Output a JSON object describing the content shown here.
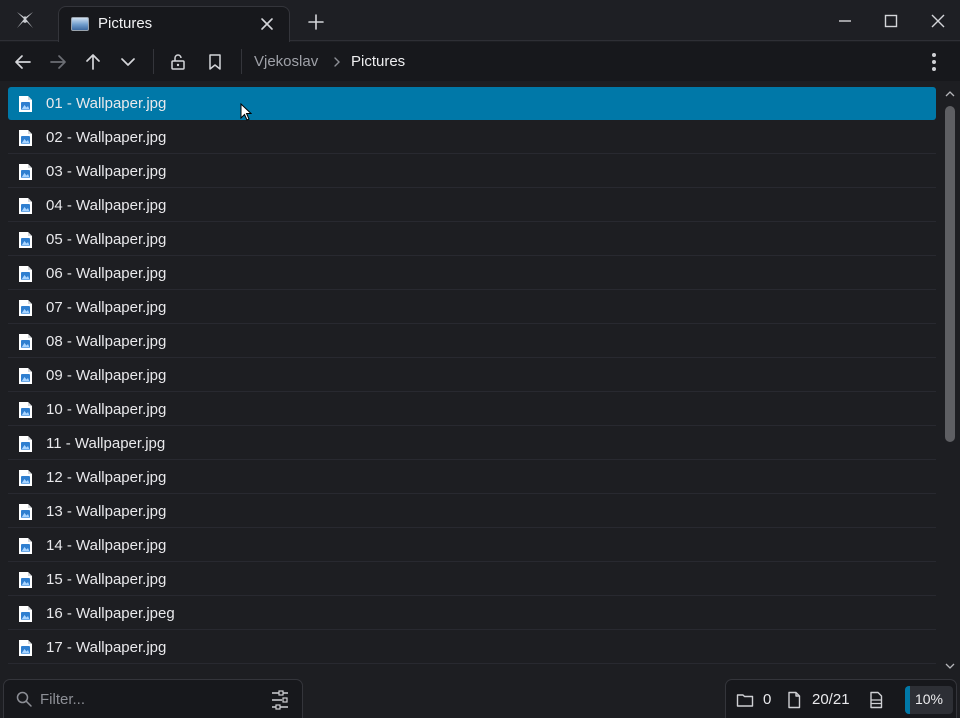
{
  "window": {
    "tab_title": "Pictures",
    "tab_icon": "pictures-folder-icon"
  },
  "toolbar": {
    "buttons": [
      "back-icon",
      "forward-icon",
      "up-icon",
      "dropdown-icon",
      "unlock-icon",
      "bookmark-icon",
      "more-icon"
    ],
    "breadcrumb": {
      "parent": "Vjekoslav",
      "current": "Pictures"
    }
  },
  "files": [
    {
      "name": "01 - Wallpaper.jpg",
      "selected": true
    },
    {
      "name": "02 - Wallpaper.jpg"
    },
    {
      "name": "03 - Wallpaper.jpg"
    },
    {
      "name": "04 - Wallpaper.jpg"
    },
    {
      "name": "05 - Wallpaper.jpg"
    },
    {
      "name": "06 - Wallpaper.jpg"
    },
    {
      "name": "07 - Wallpaper.jpg"
    },
    {
      "name": "08 - Wallpaper.jpg"
    },
    {
      "name": "09 - Wallpaper.jpg"
    },
    {
      "name": "10 - Wallpaper.jpg"
    },
    {
      "name": "11 - Wallpaper.jpg"
    },
    {
      "name": "12 - Wallpaper.jpg"
    },
    {
      "name": "13 - Wallpaper.jpg"
    },
    {
      "name": "14 - Wallpaper.jpg"
    },
    {
      "name": "15 - Wallpaper.jpg"
    },
    {
      "name": "16 - Wallpaper.jpeg"
    },
    {
      "name": "17 - Wallpaper.jpg"
    }
  ],
  "status": {
    "filter_placeholder": "Filter...",
    "folder_count": "0",
    "file_count": "20/21",
    "zoom": "10%",
    "zoom_fraction": 0.1
  },
  "colors": {
    "accent": "#0078a8",
    "background": "#17181c"
  }
}
